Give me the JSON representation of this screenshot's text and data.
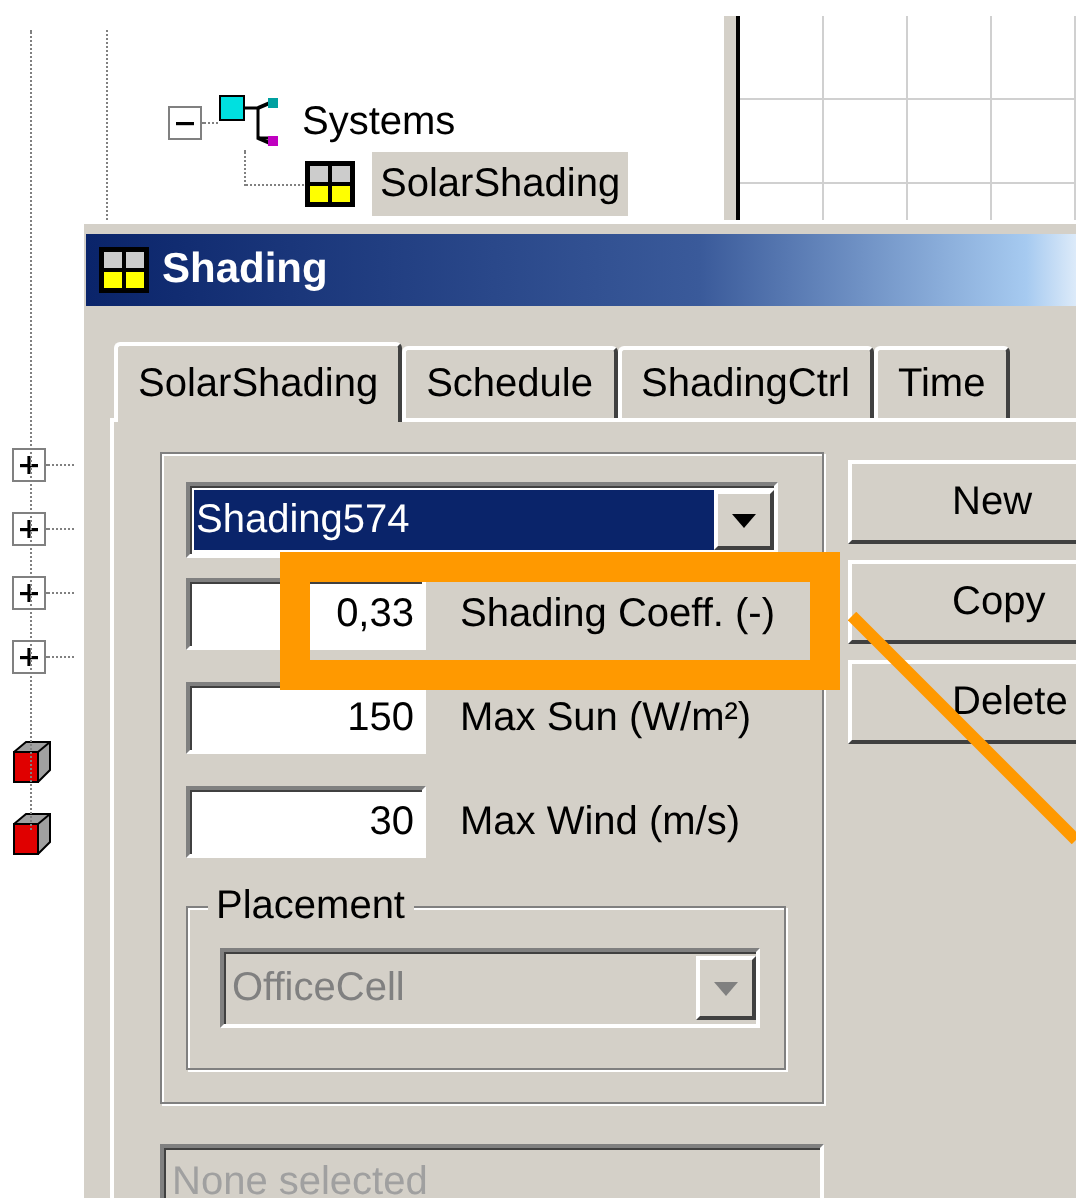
{
  "tree": {
    "items": [
      {
        "label": "Systems",
        "expanded": true,
        "children": [
          {
            "label": "SolarShading",
            "selected": true
          }
        ]
      }
    ]
  },
  "side_nodes": [
    {
      "expanded": false
    },
    {
      "expanded": false
    },
    {
      "expanded": false
    },
    {
      "expanded": false
    }
  ],
  "dialog": {
    "title": "Shading",
    "tabs": [
      {
        "label": "SolarShading",
        "selected": true
      },
      {
        "label": "Schedule",
        "selected": false
      },
      {
        "label": "ShadingCtrl",
        "selected": false
      },
      {
        "label": "Time",
        "selected": false
      }
    ],
    "shading_combo": {
      "value": "Shading574",
      "selected": true
    },
    "fields": [
      {
        "value": "0,33",
        "label": "Shading Coeff. (-)"
      },
      {
        "value": "150",
        "label": "Max Sun (W/m²)"
      },
      {
        "value": "30",
        "label": "Max Wind (m/s)"
      }
    ],
    "placement": {
      "title": "Placement",
      "value": "OfficeCell",
      "disabled": true
    },
    "buttons": [
      "New",
      "Copy",
      "Delete"
    ],
    "selection_field": {
      "value": "None selected",
      "disabled": true
    }
  }
}
